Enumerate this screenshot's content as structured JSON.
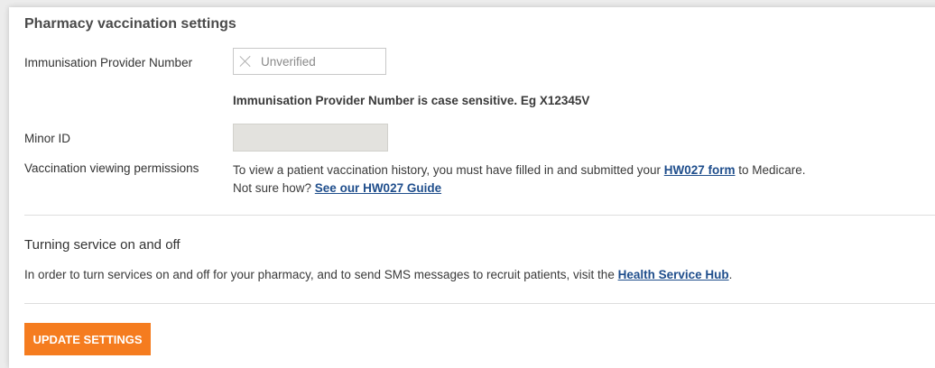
{
  "section": {
    "title": "Pharmacy vaccination settings"
  },
  "immunisation": {
    "label": "Immunisation Provider Number",
    "status_icon": "close-icon",
    "value": "Unverified",
    "hint": "Immunisation Provider Number is case sensitive. Eg X12345V"
  },
  "minor_id": {
    "label": "Minor ID",
    "value": ""
  },
  "permissions": {
    "label": "Vaccination viewing permissions",
    "line1_prefix": "To view a patient vaccination history, you must have filled in and submitted your ",
    "form_link": "HW027 form",
    "line1_suffix": " to Medicare.",
    "line2_prefix": "Not sure how? ",
    "guide_link": "See our HW027 Guide"
  },
  "services": {
    "title": "Turning service on and off",
    "text_prefix": "In order to turn services on and off for your pharmacy, and to send SMS messages to recruit patients, visit the ",
    "hub_link": "Health Service Hub",
    "text_suffix": "."
  },
  "actions": {
    "update_label": "UPDATE SETTINGS"
  },
  "colors": {
    "accent": "#f57c1f",
    "link": "#1f4e8c"
  }
}
